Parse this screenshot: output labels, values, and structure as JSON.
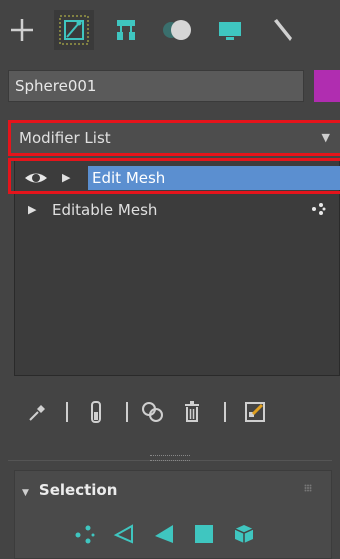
{
  "command_panel": {
    "tabs": [
      {
        "name": "create",
        "icon": "plus-icon"
      },
      {
        "name": "modify",
        "icon": "modify-icon",
        "active": true
      },
      {
        "name": "hierarchy",
        "icon": "hierarchy-icon"
      },
      {
        "name": "motion",
        "icon": "motion-icon"
      },
      {
        "name": "display",
        "icon": "display-icon"
      },
      {
        "name": "utilities",
        "icon": "wrench-icon"
      }
    ]
  },
  "object": {
    "name": "Sphere001",
    "color": "#b02db0"
  },
  "modifier_list": {
    "label": "Modifier List"
  },
  "stack": {
    "items": [
      {
        "label": "Edit Mesh",
        "selected": true,
        "visible": true
      },
      {
        "label": "Editable Mesh",
        "selected": false
      }
    ]
  },
  "stack_toolbar": {
    "icons": [
      "pin-stack-icon",
      "show-end-result-icon",
      "make-unique-icon",
      "remove-modifier-icon",
      "configure-modifier-sets-icon"
    ]
  },
  "selection": {
    "title": "Selection",
    "icons": [
      "vertex-icon",
      "edge-icon",
      "face-icon",
      "polygon-icon",
      "element-icon"
    ]
  },
  "colors": {
    "accent_teal": "#3fc6c0",
    "selection_blue": "#5b8fd0",
    "highlight_red": "#e5141b"
  }
}
